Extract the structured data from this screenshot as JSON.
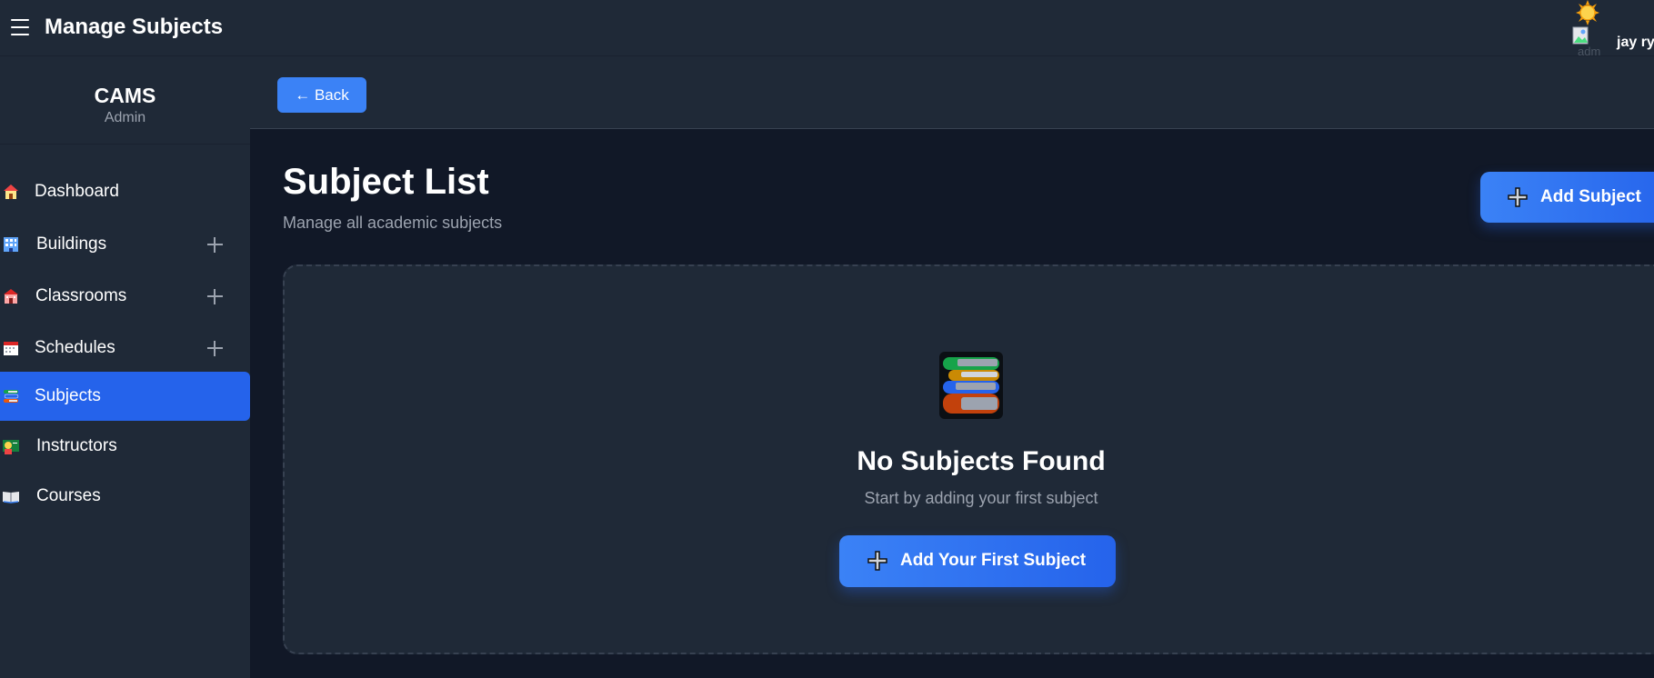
{
  "header": {
    "title": "Manage Subjects",
    "theme_toggle_icon": "sun-icon",
    "avatar_alt": "adm",
    "username": "jay ry"
  },
  "sidebar": {
    "brand": "CAMS",
    "role": "Admin",
    "items": [
      {
        "label": "Dashboard",
        "icon": "house-icon",
        "has_add": false,
        "active": false
      },
      {
        "label": "Buildings",
        "icon": "building-icon",
        "has_add": true,
        "active": false
      },
      {
        "label": "Classrooms",
        "icon": "school-icon",
        "has_add": true,
        "active": false
      },
      {
        "label": "Schedules",
        "icon": "calendar-icon",
        "has_add": true,
        "active": false
      },
      {
        "label": "Subjects",
        "icon": "books-icon",
        "has_add": false,
        "active": true
      },
      {
        "label": "Instructors",
        "icon": "teacher-icon",
        "has_add": false,
        "active": false
      },
      {
        "label": "Courses",
        "icon": "open-book-icon",
        "has_add": false,
        "active": false
      }
    ]
  },
  "toolbar": {
    "back_label": "← Back"
  },
  "main": {
    "title": "Subject List",
    "subtitle": "Manage all academic subjects",
    "add_button_label": "Add Subject",
    "empty_state": {
      "icon": "books-stack-icon",
      "title": "No Subjects Found",
      "message": "Start by adding your first subject",
      "button_label": "Add Your First Subject"
    }
  },
  "colors": {
    "accent": "#2563eb",
    "accent_light": "#3b82f6",
    "background": "#111827",
    "panel": "#1f2937",
    "muted_text": "#9ca3af"
  }
}
